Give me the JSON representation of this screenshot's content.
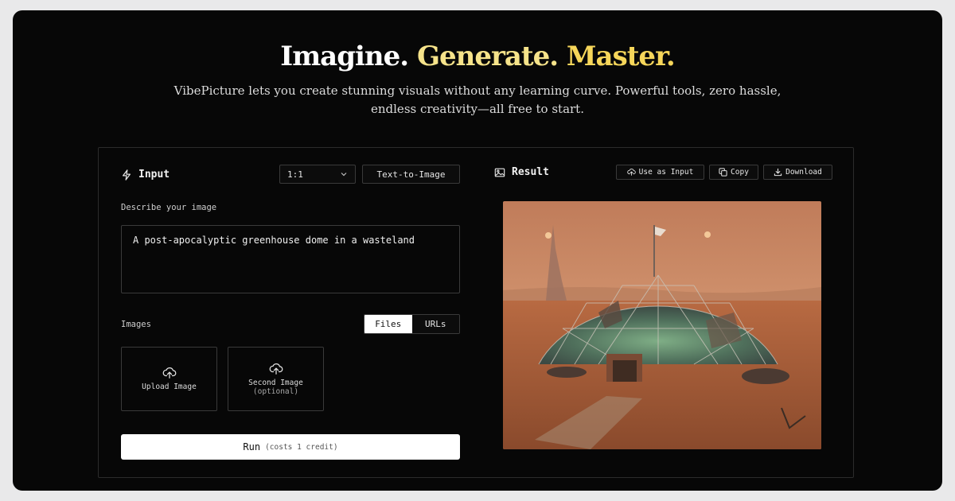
{
  "hero": {
    "title_part1": "Imagine.",
    "title_part2": "Generate.",
    "title_part3": "Master.",
    "subtitle": "VibePicture lets you create stunning visuals without any learning curve. Powerful tools, zero hassle, endless creativity—all free to start."
  },
  "input": {
    "title": "Input",
    "icon": "lightning-icon",
    "ratio_value": "1:1",
    "mode_label": "Text-to-Image",
    "describe_label": "Describe your image",
    "prompt_value": "A post-apocalyptic greenhouse dome in a wasteland",
    "images_label": "Images",
    "tabs": [
      "Files",
      "URLs"
    ],
    "upload1": "Upload Image",
    "upload2_line1": "Second Image",
    "upload2_line2": "(optional)",
    "run_label": "Run",
    "run_cost": "(costs 1 credit)"
  },
  "result": {
    "title": "Result",
    "icon": "image-icon",
    "use_as_input": "Use as Input",
    "copy": "Copy",
    "download": "Download"
  },
  "colors": {
    "background": "#070707",
    "accent_yellow": "#f6d65a",
    "pale_yellow": "#f6e38a"
  }
}
